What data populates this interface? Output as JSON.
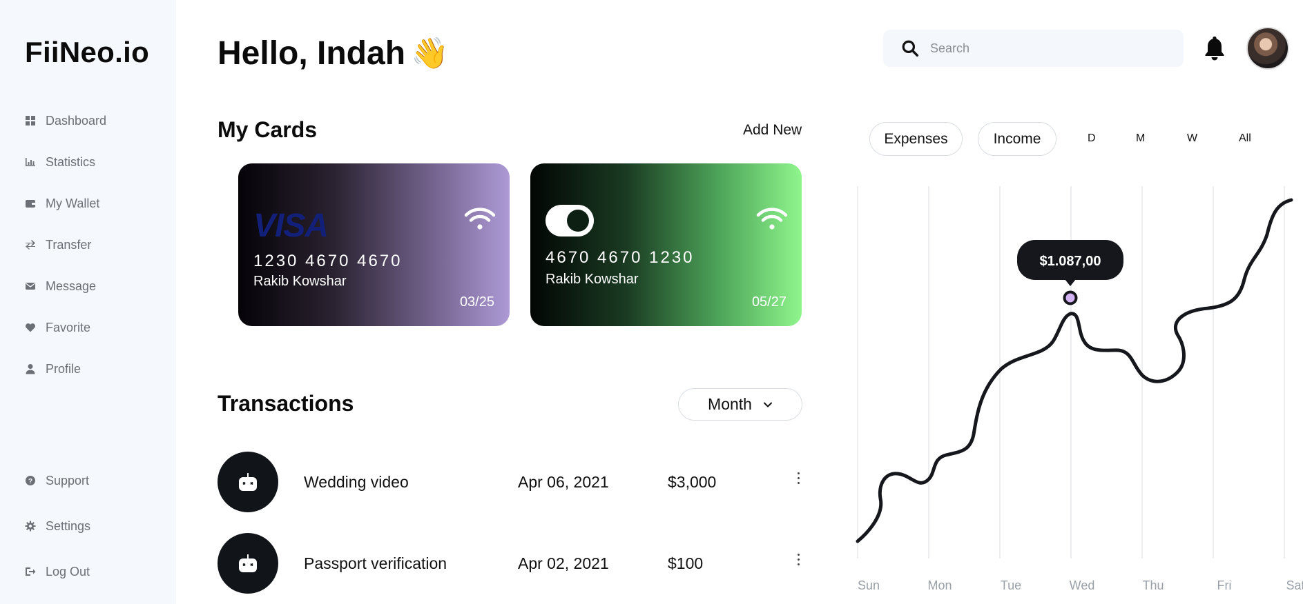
{
  "app": {
    "logo": "FiiNeo.io"
  },
  "sidebar": {
    "items": [
      {
        "label": "Dashboard",
        "icon": "dashboard-icon"
      },
      {
        "label": "Statistics",
        "icon": "statistics-icon"
      },
      {
        "label": "My Wallet",
        "icon": "wallet-icon"
      },
      {
        "label": "Transfer",
        "icon": "transfer-icon"
      },
      {
        "label": "Message",
        "icon": "message-icon"
      },
      {
        "label": "Favorite",
        "icon": "heart-icon"
      },
      {
        "label": "Profile",
        "icon": "user-icon"
      }
    ],
    "bottom_items": [
      {
        "label": "Support",
        "icon": "question-icon"
      },
      {
        "label": "Settings",
        "icon": "gear-icon"
      },
      {
        "label": "Log Out",
        "icon": "logout-icon"
      }
    ]
  },
  "header": {
    "greeting": "Hello, Indah",
    "wave_emoji": "👋",
    "search_placeholder": "Search"
  },
  "cards": {
    "title": "My Cards",
    "add_new": "Add New",
    "items": [
      {
        "brand": "VISA",
        "number": "1230 4670 4670",
        "holder": "Rakib Kowshar",
        "expiry": "03/25",
        "gradient": [
          "#050308",
          "#ad9ad6"
        ]
      },
      {
        "brand": "toggle",
        "number": "4670 4670 1230",
        "holder": "Rakib Kowshar",
        "expiry": "05/27",
        "gradient": [
          "#020604",
          "#8ff58c"
        ]
      }
    ]
  },
  "transactions": {
    "title": "Transactions",
    "filter": "Month",
    "rows": [
      {
        "name": "Wedding video",
        "date": "Apr 06, 2021",
        "amount": "$3,000"
      },
      {
        "name": "Passport verification",
        "date": "Apr 02, 2021",
        "amount": "$100"
      }
    ]
  },
  "chart_controls": {
    "expenses": "Expenses",
    "income": "Income",
    "periods": [
      "D",
      "M",
      "W",
      "All"
    ]
  },
  "chart_data": {
    "type": "line",
    "categories": [
      "Sun",
      "Mon",
      "Tue",
      "Wed",
      "Thu",
      "Fri",
      "Sat"
    ],
    "tooltip": {
      "label": "$1.087,00",
      "category": "Wed"
    },
    "grid": true,
    "line_color": "#15171c",
    "marker_color": "#d4b3f2"
  }
}
